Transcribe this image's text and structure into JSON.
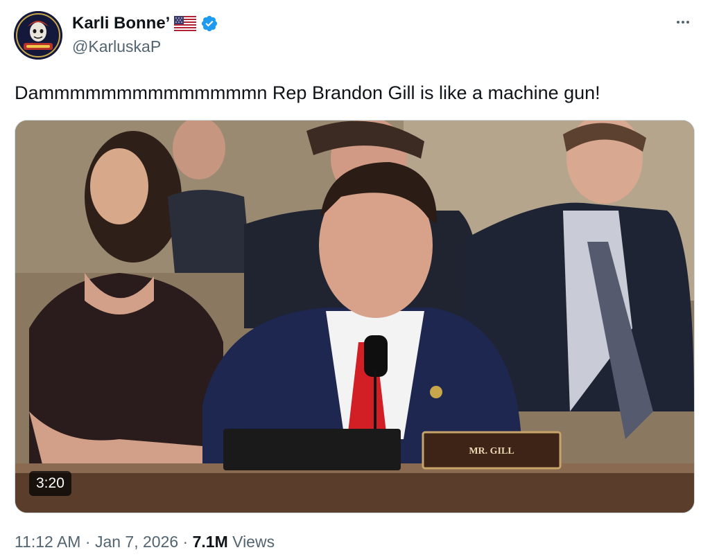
{
  "author": {
    "display_name": "Karli Bonne’",
    "handle": "@KarluskaP",
    "avatar_icon": "avatar-image",
    "flag_icon": "us-flag-icon",
    "verified_icon": "verified-badge-icon",
    "verified_color": "#1d9bf0"
  },
  "more_icon": "more-horizontal-icon",
  "tweet": {
    "text": "Dammmmmmmmmmmmmmn Rep Brandon Gill is like a machine gun!"
  },
  "media": {
    "type": "video",
    "duration": "3:20",
    "nameplate": "MR. GILL"
  },
  "meta": {
    "time": "11:12 AM",
    "separator1": " · ",
    "date": "Jan 7, 2026",
    "separator2": " · ",
    "views_count": "7.1M",
    "views_label": " Views"
  },
  "colors": {
    "text_primary": "#0f1419",
    "text_secondary": "#536471",
    "border": "#cfd9de"
  }
}
